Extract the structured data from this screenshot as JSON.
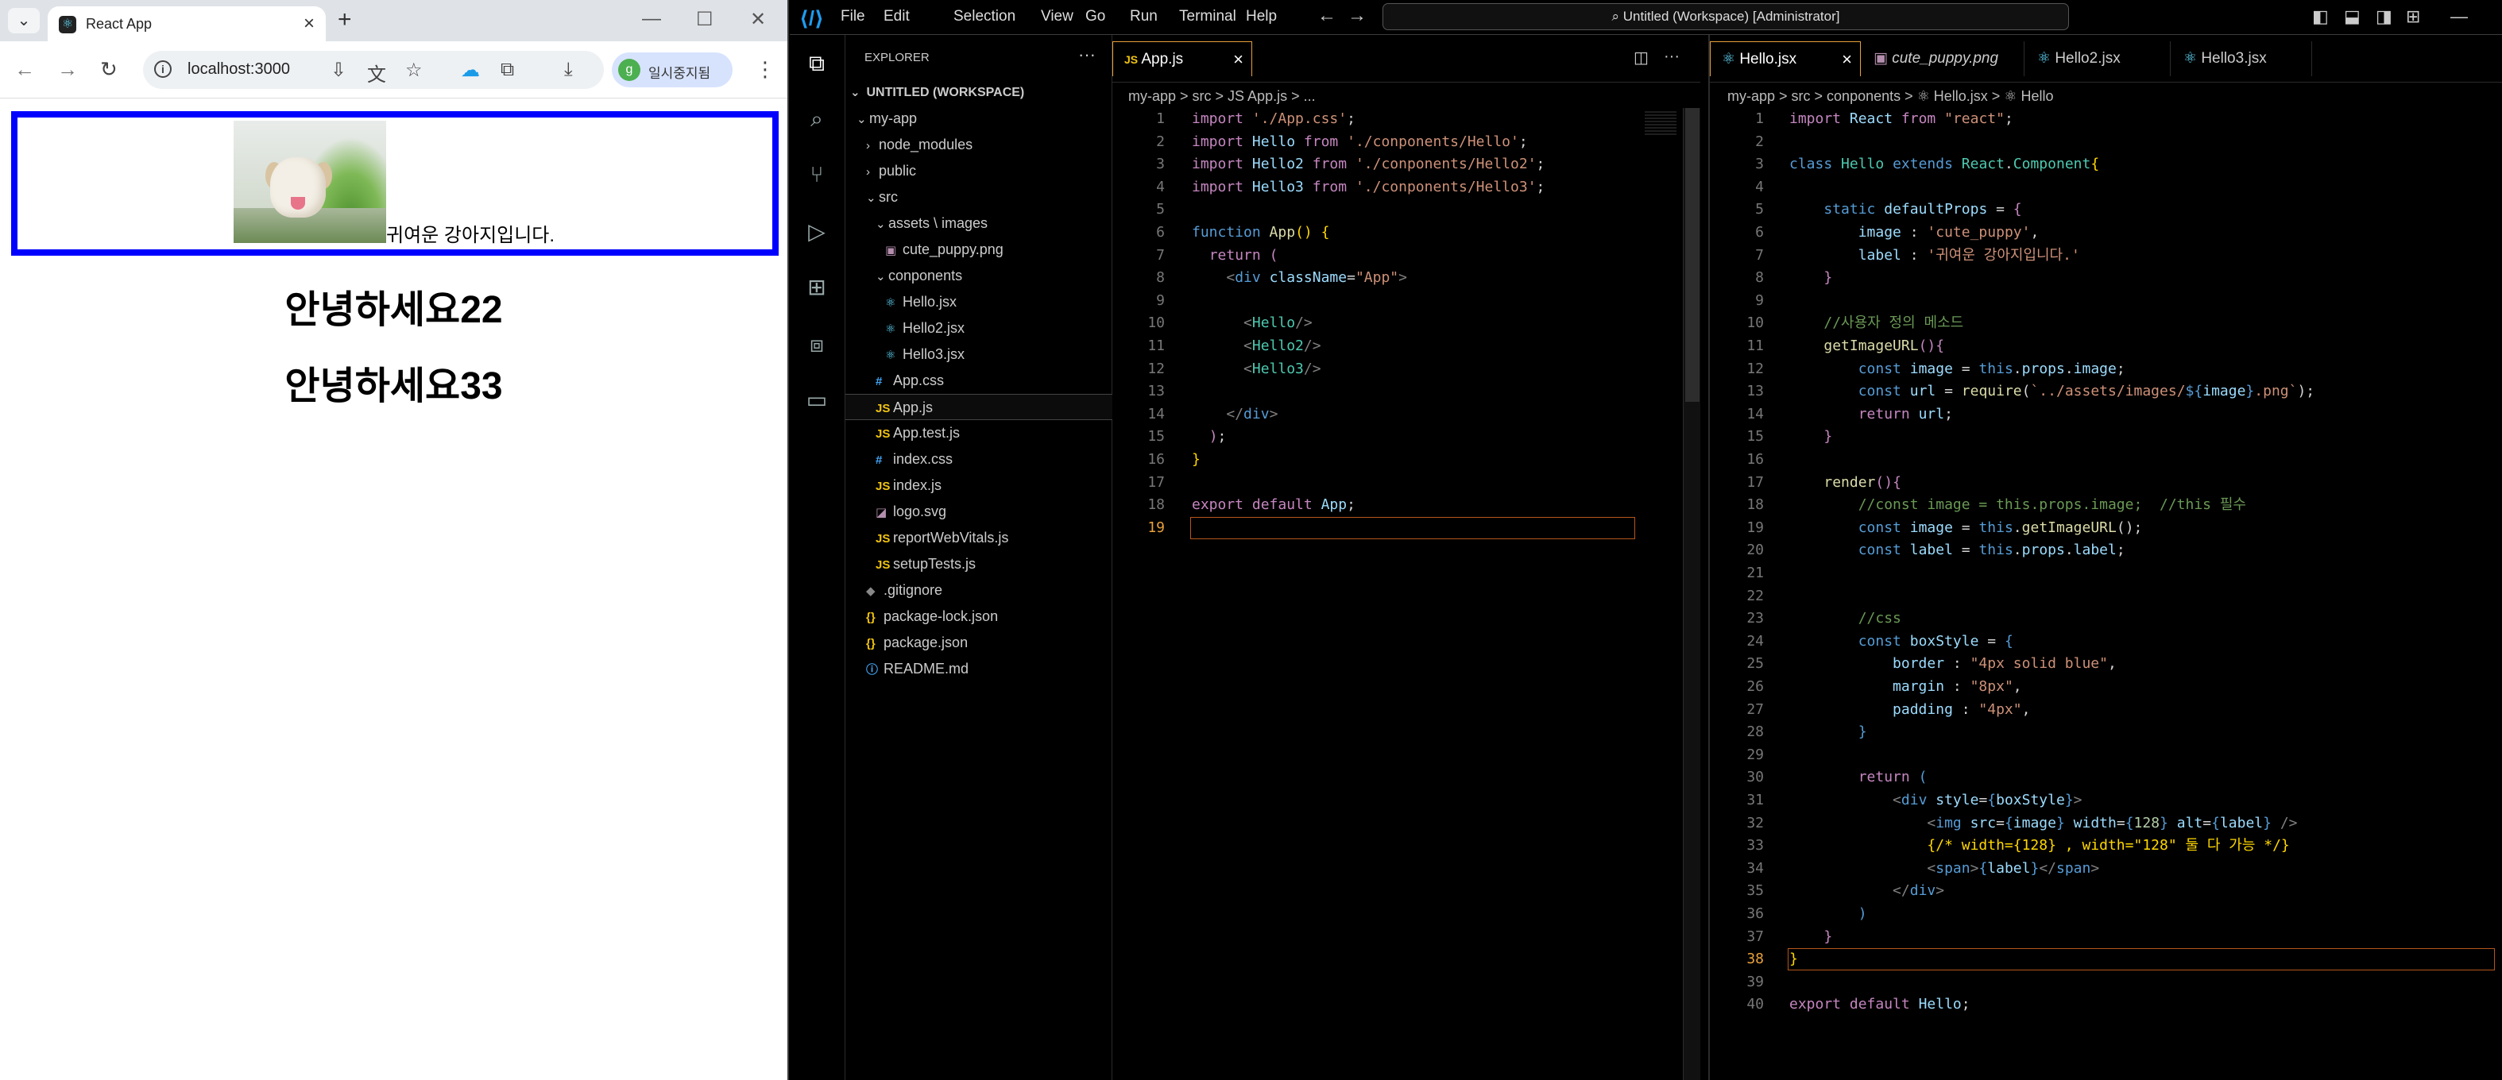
{
  "browser": {
    "tab_title": "React App",
    "url": "localhost:3000",
    "profile_label": "일시중지됨",
    "profile_initial": "g",
    "page": {
      "hello_label": "귀여운 강아지입니다.",
      "heading2": "안녕하세요22",
      "heading3": "안녕하세요33"
    }
  },
  "vscode": {
    "menu": [
      "File",
      "Edit",
      "Selection",
      "View",
      "Go",
      "Run",
      "Terminal",
      "Help"
    ],
    "command_center": "Untitled (Workspace) [Administrator]",
    "explorer_title": "EXPLORER",
    "workspace": "UNTITLED (WORKSPACE)",
    "tree": [
      {
        "label": "my-app",
        "depth": 1,
        "kind": "folder-open"
      },
      {
        "label": "node_modules",
        "depth": 2,
        "kind": "folder"
      },
      {
        "label": "public",
        "depth": 2,
        "kind": "folder"
      },
      {
        "label": "src",
        "depth": 2,
        "kind": "folder-open"
      },
      {
        "label": "assets \\ images",
        "depth": 3,
        "kind": "folder-open"
      },
      {
        "label": "cute_puppy.png",
        "depth": 4,
        "kind": "image"
      },
      {
        "label": "conponents",
        "depth": 3,
        "kind": "folder-open"
      },
      {
        "label": "Hello.jsx",
        "depth": 4,
        "kind": "react"
      },
      {
        "label": "Hello2.jsx",
        "depth": 4,
        "kind": "react"
      },
      {
        "label": "Hello3.jsx",
        "depth": 4,
        "kind": "react"
      },
      {
        "label": "App.css",
        "depth": 3,
        "kind": "css"
      },
      {
        "label": "App.js",
        "depth": 3,
        "kind": "js",
        "selected": true
      },
      {
        "label": "App.test.js",
        "depth": 3,
        "kind": "js"
      },
      {
        "label": "index.css",
        "depth": 3,
        "kind": "css"
      },
      {
        "label": "index.js",
        "depth": 3,
        "kind": "js"
      },
      {
        "label": "logo.svg",
        "depth": 3,
        "kind": "svg"
      },
      {
        "label": "reportWebVitals.js",
        "depth": 3,
        "kind": "js"
      },
      {
        "label": "setupTests.js",
        "depth": 3,
        "kind": "js"
      },
      {
        "label": ".gitignore",
        "depth": 2,
        "kind": "git"
      },
      {
        "label": "package-lock.json",
        "depth": 2,
        "kind": "json"
      },
      {
        "label": "package.json",
        "depth": 2,
        "kind": "json"
      },
      {
        "label": "README.md",
        "depth": 2,
        "kind": "info"
      }
    ],
    "editor1": {
      "tabs": [
        {
          "label": "App.js",
          "icon": "JS",
          "active": true
        }
      ],
      "breadcrumb": "my-app  >  src  >  JS App.js  >  ...",
      "current_line": 19,
      "lines": [
        "<span class=\"k\">import</span> <span class=\"s\">'./App.css'</span>;",
        "<span class=\"k\">import</span> <span class=\"v\">Hello</span> <span class=\"k\">from</span> <span class=\"s\">'./conponents/Hello'</span>;",
        "<span class=\"k\">import</span> <span class=\"v\">Hello2</span> <span class=\"k\">from</span> <span class=\"s\">'./conponents/Hello2'</span>;",
        "<span class=\"k\">import</span> <span class=\"v\">Hello3</span> <span class=\"k\">from</span> <span class=\"s\">'./conponents/Hello3'</span>;",
        "",
        "<span class=\"kb\">function</span> <span class=\"f\">App</span><span class=\"y\">()</span> <span class=\"y\">{</span>",
        "  <span class=\"k\">return</span> <span class=\"k\">(</span>",
        "    <span class=\"tg\">&lt;</span><span class=\"kb\">div</span> <span class=\"v\">className</span>=<span class=\"s\">\"App\"</span><span class=\"tg\">&gt;</span>",
        "",
        "      <span class=\"tg\">&lt;</span><span class=\"t\">Hello</span><span class=\"tg\">/&gt;</span>",
        "      <span class=\"tg\">&lt;</span><span class=\"t\">Hello2</span><span class=\"tg\">/&gt;</span>",
        "      <span class=\"tg\">&lt;</span><span class=\"t\">Hello3</span><span class=\"tg\">/&gt;</span>",
        "",
        "    <span class=\"tg\">&lt;/</span><span class=\"kb\">div</span><span class=\"tg\">&gt;</span>",
        "  <span class=\"k\">)</span>;",
        "<span class=\"y\">}</span>",
        "",
        "<span class=\"k\">export</span> <span class=\"k\">default</span> <span class=\"v\">App</span>;",
        ""
      ]
    },
    "editor2": {
      "tabs": [
        {
          "label": "Hello.jsx",
          "icon": "react",
          "active": true
        },
        {
          "label": "cute_puppy.png",
          "icon": "image",
          "italic": true
        },
        {
          "label": "Hello2.jsx",
          "icon": "react"
        },
        {
          "label": "Hello3.jsx",
          "icon": "react"
        }
      ],
      "breadcrumb": "my-app  >  src  >  conponents  >  ⚛ Hello.jsx  >  ⚛ Hello",
      "current_line": 38,
      "lines": [
        "<span class=\"k\">import</span> <span class=\"v\">React</span> <span class=\"k\">from</span> <span class=\"s\">\"react\"</span>;",
        "",
        "<span class=\"kb\">class</span> <span class=\"t\">Hello</span> <span class=\"kb\">extends</span> <span class=\"t\">React</span>.<span class=\"t\">Component</span><span class=\"y\">{</span>",
        "",
        "    <span class=\"kb\">static</span> <span class=\"v\">defaultProps</span> = <span class=\"k\">{</span>",
        "        <span class=\"v\">image</span> : <span class=\"s\">'cute_puppy'</span>,",
        "        <span class=\"v\">label</span> : <span class=\"s\">'귀여운 강아지입니다.'</span>",
        "    <span class=\"k\">}</span>",
        "",
        "    <span class=\"c\">//사용자 정의 메소드</span>",
        "    <span class=\"f\">getImageURL</span><span class=\"k\">(){</span>",
        "        <span class=\"kb\">const</span> <span class=\"v\">image</span> = <span class=\"kb\">this</span>.<span class=\"v\">props</span>.<span class=\"v\">image</span>;",
        "        <span class=\"kb\">const</span> <span class=\"v\">url</span> = <span class=\"f\">require</span>(<span class=\"s\">`../assets/images/</span><span class=\"kb\">${</span><span class=\"v\">image</span><span class=\"kb\">}</span><span class=\"s\">.png`</span>);",
        "        <span class=\"k\">return</span> <span class=\"v\">url</span>;",
        "    <span class=\"k\">}</span>",
        "",
        "    <span class=\"f\">render</span><span class=\"k\">(){</span>",
        "        <span class=\"c\">//const image = this.props.image;  //this 필수</span>",
        "        <span class=\"kb\">const</span> <span class=\"v\">image</span> = <span class=\"kb\">this</span>.<span class=\"f\">getImageURL</span>();",
        "        <span class=\"kb\">const</span> <span class=\"v\">label</span> = <span class=\"kb\">this</span>.<span class=\"v\">props</span>.<span class=\"v\">label</span>;",
        "",
        "",
        "        <span class=\"c\">//css</span>",
        "        <span class=\"kb\">const</span> <span class=\"v\">boxStyle</span> = <span class=\"kb\">{</span>",
        "            <span class=\"v\">border</span> : <span class=\"s\">\"4px solid blue\"</span>,",
        "            <span class=\"v\">margin</span> : <span class=\"s\">\"8px\"</span>,",
        "            <span class=\"v\">padding</span> : <span class=\"s\">\"4px\"</span>,",
        "        <span class=\"kb\">}</span>",
        "",
        "        <span class=\"k\">return</span> <span class=\"kb\">(</span>",
        "            <span class=\"tg\">&lt;</span><span class=\"kb\">div</span> <span class=\"v\">style</span>=<span class=\"kb\">{</span><span class=\"v\">boxStyle</span><span class=\"kb\">}</span><span class=\"tg\">&gt;</span>",
        "                <span class=\"tg\">&lt;</span><span class=\"kb\">img</span> <span class=\"v\">src</span>=<span class=\"kb\">{</span><span class=\"v\">image</span><span class=\"kb\">}</span> <span class=\"v\">width</span>=<span class=\"kb\">{</span><span class=\"n\">128</span><span class=\"kb\">}</span> <span class=\"v\">alt</span>=<span class=\"kb\">{</span><span class=\"v\">label</span><span class=\"kb\">}</span> <span class=\"tg\">/&gt;</span>",
        "                <span class=\"y\">{/* width={128} , width=\"128\" 둘 다 가능 */}</span>",
        "                <span class=\"tg\">&lt;</span><span class=\"kb\">span</span><span class=\"tg\">&gt;</span><span class=\"kb\">{</span><span class=\"v\">label</span><span class=\"kb\">}</span><span class=\"tg\">&lt;/</span><span class=\"kb\">span</span><span class=\"tg\">&gt;</span>",
        "            <span class=\"tg\">&lt;/</span><span class=\"kb\">div</span><span class=\"tg\">&gt;</span>",
        "        <span class=\"kb\">)</span>",
        "    <span class=\"k\">}</span>",
        "<span class=\"y\">}</span>",
        "",
        "<span class=\"k\">export</span> <span class=\"k\">default</span> <span class=\"v\">Hello</span>;"
      ]
    }
  }
}
